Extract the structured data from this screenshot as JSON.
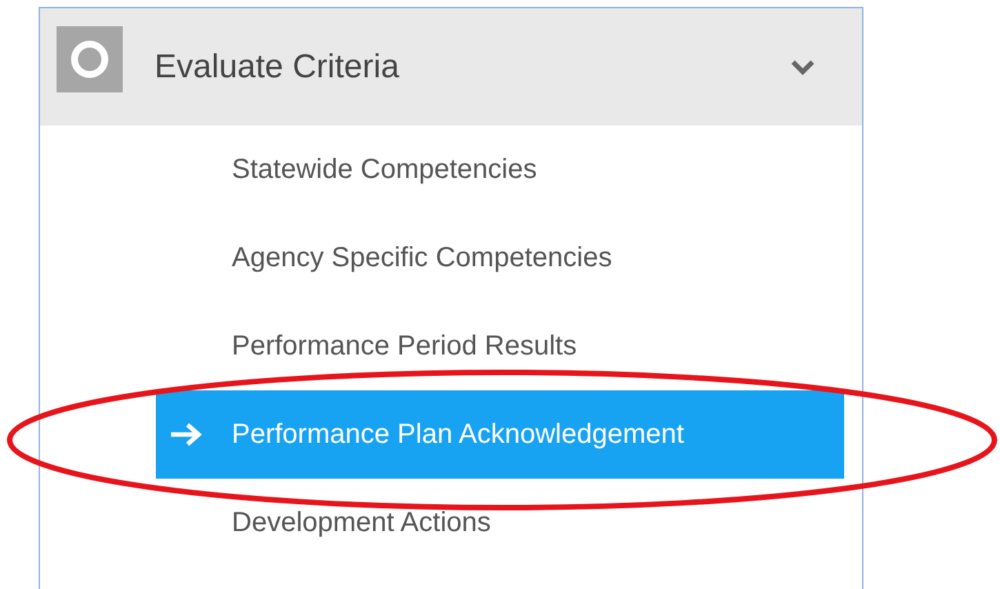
{
  "section": {
    "title": "Evaluate Criteria",
    "expanded": true
  },
  "items": [
    {
      "label": "Statewide Competencies",
      "selected": false
    },
    {
      "label": "Agency Specific Competencies",
      "selected": false
    },
    {
      "label": "Performance Period Results",
      "selected": false
    },
    {
      "label": "Performance Plan Acknowledgement",
      "selected": true
    },
    {
      "label": "Development Actions",
      "selected": false
    }
  ],
  "annotation": {
    "kind": "ellipse"
  }
}
